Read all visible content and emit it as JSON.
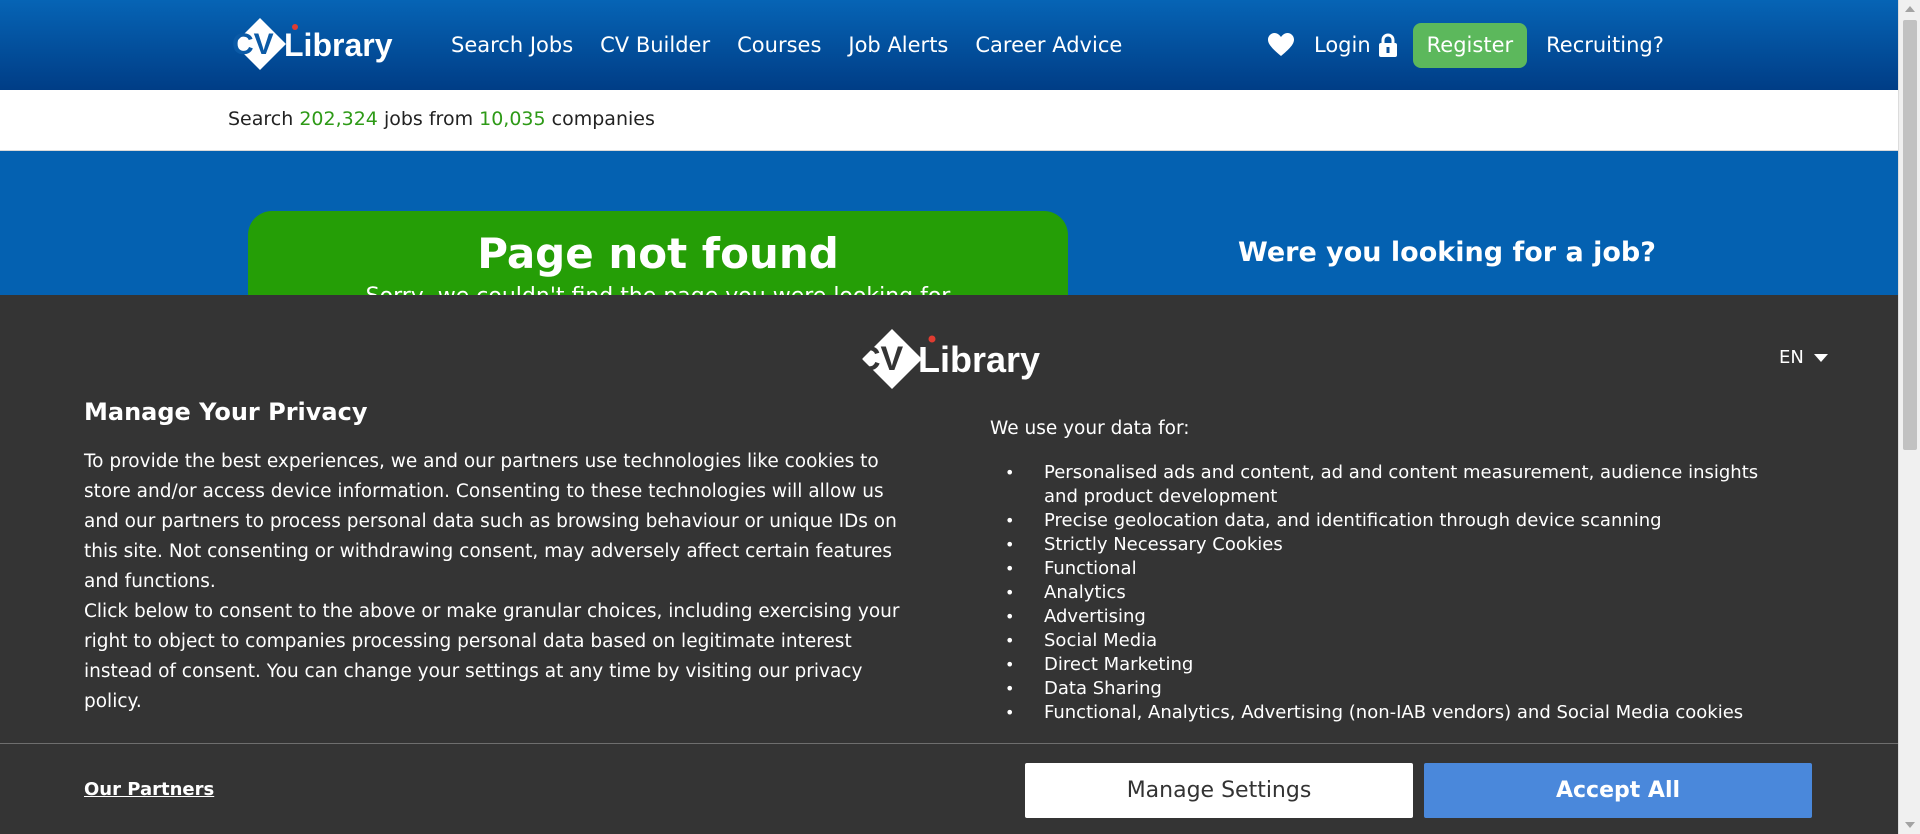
{
  "header": {
    "logo_text": "CV Library",
    "nav": [
      "Search Jobs",
      "CV Builder",
      "Courses",
      "Job Alerts",
      "Career Advice"
    ],
    "login_label": "Login",
    "register_label": "Register",
    "recruiting_label": "Recruiting?",
    "icons": {
      "favourite": "heart-icon",
      "login": "lock-icon"
    }
  },
  "stats": {
    "prefix": "Search",
    "jobs_count": "202,324",
    "middle": "jobs from",
    "companies_count": "10,035",
    "suffix": "companies"
  },
  "hero": {
    "title": "Page not found",
    "subtitle": "Sorry, we couldn't find the page you were looking for",
    "looking_prompt": "Were you looking for a job?"
  },
  "consent": {
    "language": "EN",
    "title": "Manage Your Privacy",
    "body_p1": "To provide the best experiences, we and our partners use technologies like cookies to store and/or access device information. Consenting to these technologies will allow us and our partners to process personal data such as browsing behaviour or unique IDs on this site. Not consenting or withdrawing consent, may adversely affect certain features and functions.",
    "body_p2": "Click below to consent to the above or make granular choices, including exercising your right to object to companies processing personal data based on legitimate interest instead of consent. You can change your settings at any time by visiting our privacy policy.",
    "use_heading": "We use your data for:",
    "purposes": [
      "Personalised ads and content, ad and content measurement, audience insights and product development",
      "Precise geolocation data, and identification through device scanning",
      "Strictly Necessary Cookies",
      "Functional",
      "Analytics",
      "Advertising",
      "Social Media",
      "Direct Marketing",
      "Data Sharing",
      "Functional, Analytics, Advertising (non-IAB vendors) and Social Media cookies"
    ],
    "partners_link": "Our Partners",
    "manage_label": "Manage Settings",
    "accept_label": "Accept All"
  },
  "colors": {
    "header_blue": "#0664b5",
    "stat_green": "#2e9a17",
    "register_green": "#5cb85c",
    "notfound_green": "#259e06",
    "overlay_bg": "#343434",
    "accept_blue": "#4a88db"
  }
}
